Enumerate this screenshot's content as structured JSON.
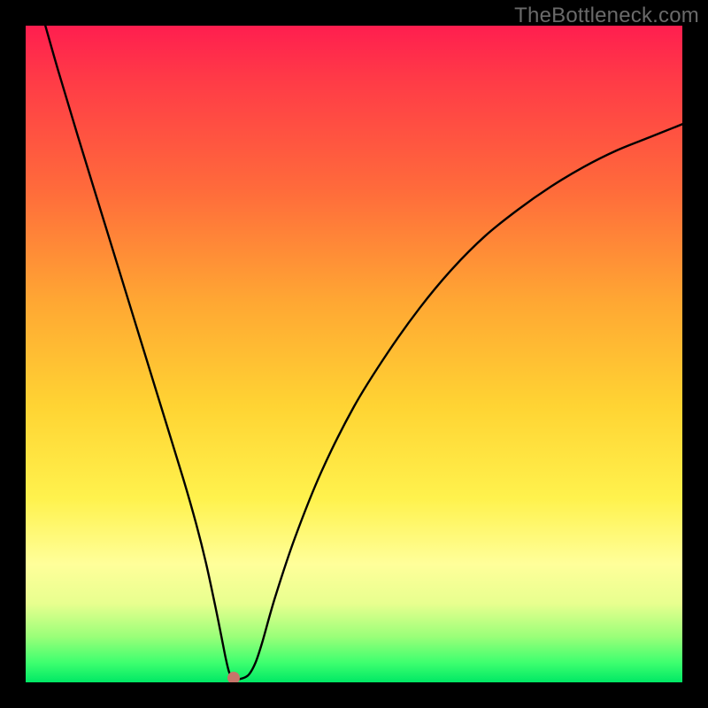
{
  "watermark": "TheBottleneck.com",
  "chart_data": {
    "type": "line",
    "title": "",
    "xlabel": "",
    "ylabel": "",
    "xlim": [
      0,
      100
    ],
    "ylim": [
      0,
      100
    ],
    "series": [
      {
        "name": "curve",
        "x": [
          3,
          5,
          8,
          12,
          16,
          20,
          24,
          26,
          27.5,
          29,
          30,
          30.5,
          31,
          31.5,
          32,
          33,
          34,
          35,
          36,
          38,
          41,
          45,
          50,
          55,
          60,
          65,
          70,
          75,
          80,
          85,
          90,
          95,
          100
        ],
        "y": [
          100,
          93,
          83,
          70,
          57,
          44,
          31,
          24,
          18,
          11,
          6,
          3.5,
          1.5,
          0.8,
          0.5,
          0.6,
          1.2,
          3,
          6,
          13,
          22,
          32,
          42,
          50,
          57,
          63,
          68,
          72,
          75.5,
          78.5,
          81,
          83,
          85
        ]
      }
    ],
    "marker": {
      "x": 31.7,
      "y": 0.7
    },
    "gradient_colors": [
      "#ff1e4f",
      "#ff6b3b",
      "#ffd433",
      "#ffff9a",
      "#00e865"
    ]
  }
}
